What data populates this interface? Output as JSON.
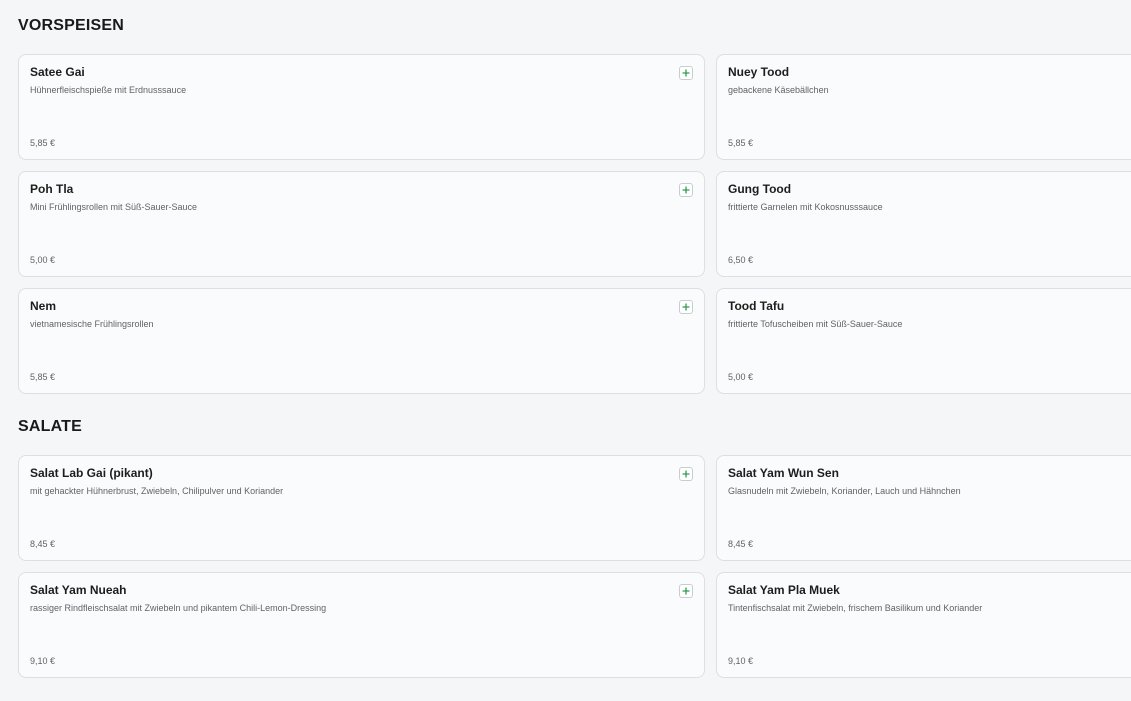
{
  "sections": [
    {
      "title": "VORSPEISEN",
      "items": [
        {
          "name": "Satee Gai",
          "desc": "Hühnerfleischspieße mit Erdnusssauce",
          "price": "5,85 €"
        },
        {
          "name": "Nuey Tood",
          "desc": "gebackene Käsebällchen",
          "price": "5,85 €"
        },
        {
          "name": "Poh Tla",
          "desc": "Mini Frühlingsrollen mit Süß-Sauer-Sauce",
          "price": "5,00 €"
        },
        {
          "name": "Gung Tood",
          "desc": "frittierte Garnelen mit Kokosnusssauce",
          "price": "6,50 €"
        },
        {
          "name": "Nem",
          "desc": "vietnamesische Frühlingsrollen",
          "price": "5,85 €"
        },
        {
          "name": "Tood Tafu",
          "desc": "frittierte Tofuscheiben mit Süß-Sauer-Sauce",
          "price": "5,00 €"
        }
      ]
    },
    {
      "title": "SALATE",
      "items": [
        {
          "name": "Salat Lab Gai (pikant)",
          "desc": "mit gehackter Hühnerbrust, Zwiebeln, Chilipulver und Koriander",
          "price": "8,45 €"
        },
        {
          "name": "Salat Yam Wun Sen",
          "desc": "Glasnudeln mit Zwiebeln, Koriander, Lauch und Hähnchen",
          "price": "8,45 €"
        },
        {
          "name": "Salat Yam Nueah",
          "desc": "rassiger Rindfleischsalat mit Zwiebeln und pikantem Chili-Lemon-Dressing",
          "price": "9,10 €"
        },
        {
          "name": "Salat Yam Pla Muek",
          "desc": "Tintenfischsalat mit Zwiebeln, frischem Basilikum und Koriander",
          "price": "9,10 €"
        }
      ]
    }
  ],
  "icons": {
    "add": "plus-icon"
  },
  "colors": {
    "accent": "#2e9e4f",
    "card_border": "#dcdfe3",
    "background": "#f5f6f7"
  }
}
